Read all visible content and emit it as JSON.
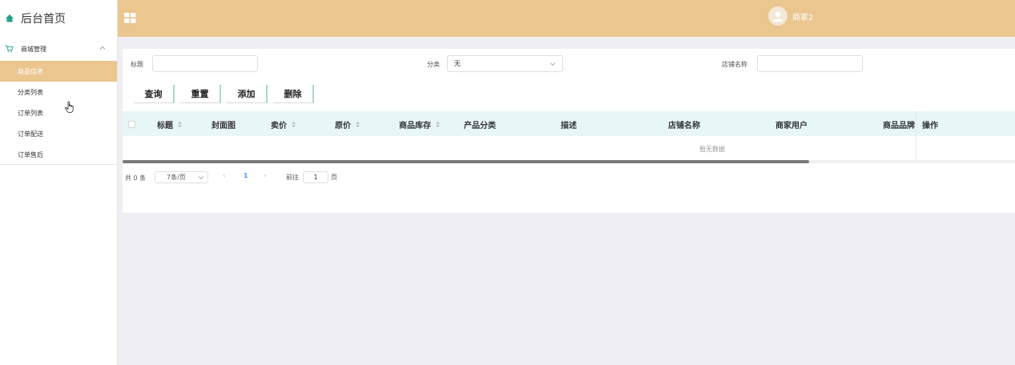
{
  "sidebar": {
    "title": "后台首页",
    "group": "商城管理",
    "items": [
      {
        "label": "商品信息",
        "active": true
      },
      {
        "label": "分类列表",
        "active": false
      },
      {
        "label": "订单列表",
        "active": false
      },
      {
        "label": "订单配送",
        "active": false
      },
      {
        "label": "订单售后",
        "active": false
      }
    ]
  },
  "header": {
    "user_name": "商家2"
  },
  "filters": {
    "title_label": "标题",
    "title_value": "",
    "category_label": "分类",
    "category_value": "无",
    "shop_label": "店铺名称",
    "shop_value": ""
  },
  "buttons": {
    "search": "查询",
    "reset": "重置",
    "add": "添加",
    "delete": "删除"
  },
  "table": {
    "columns": [
      "标题",
      "封面图",
      "卖价",
      "原价",
      "商品库存",
      "产品分类",
      "描述",
      "店铺名称",
      "商家用户",
      "商品品牌",
      "操作"
    ],
    "empty_text": "暂无数据"
  },
  "pagination": {
    "total": "共 0 条",
    "page_size": "7条/页",
    "current_page": "1",
    "goto_label": "前往",
    "goto_value": "1",
    "page_unit": "页"
  },
  "colors": {
    "accent": "#ebc68f",
    "table_header_bg": "#e7f7f6",
    "button_accent": "#a8dcc1"
  }
}
